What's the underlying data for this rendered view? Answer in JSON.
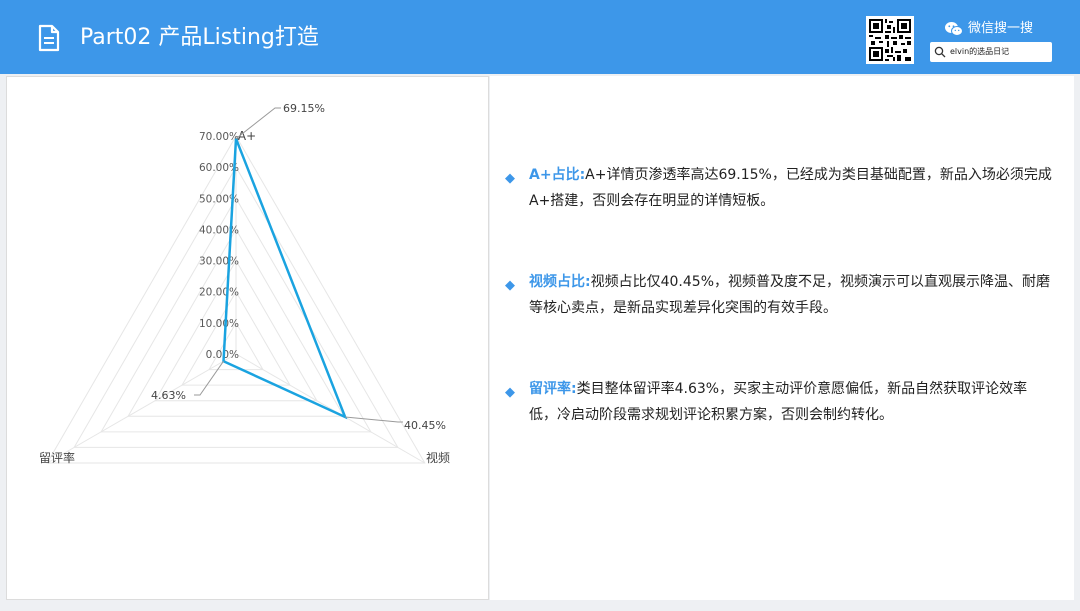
{
  "header": {
    "title": "Part02 产品Listing打造",
    "wechat_label": "微信搜一搜",
    "search_text": "elvin的选品日记",
    "icons": {
      "document": "document-icon",
      "qr": "qr-code-icon",
      "wechat": "wechat-icon",
      "search": "search-icon"
    }
  },
  "colors": {
    "header_bg": "#3d97e9",
    "series_line": "#1aa3e0",
    "accent": "#3d97e9"
  },
  "chart_data": {
    "type": "radar",
    "axes": [
      "A+",
      "视频",
      "留评率"
    ],
    "series": [
      {
        "values": [
          69.15,
          40.45,
          4.63
        ],
        "data_labels": [
          "69.15%",
          "40.45%",
          "4.63%"
        ]
      }
    ],
    "radial_ticks": [
      "0.00%",
      "10.00%",
      "20.00%",
      "30.00%",
      "40.00%",
      "50.00%",
      "60.00%",
      "70.00%"
    ],
    "range": [
      0,
      70
    ],
    "grid": true,
    "legend": "none"
  },
  "bullets": [
    {
      "head": "A+占比:",
      "body": "A+详情页渗透率高达69.15%，已经成为类目基础配置，新品入场必须完成A+搭建，否则会存在明显的详情短板。"
    },
    {
      "head": "视频占比:",
      "body": "视频占比仅40.45%，视频普及度不足，视频演示可以直观展示降温、耐磨等核心卖点，是新品实现差异化突围的有效手段。"
    },
    {
      "head": "留评率:",
      "body": "类目整体留评率4.63%，买家主动评价意愿偏低，新品自然获取评论效率低，冷启动阶段需求规划评论积累方案，否则会制约转化。"
    }
  ]
}
